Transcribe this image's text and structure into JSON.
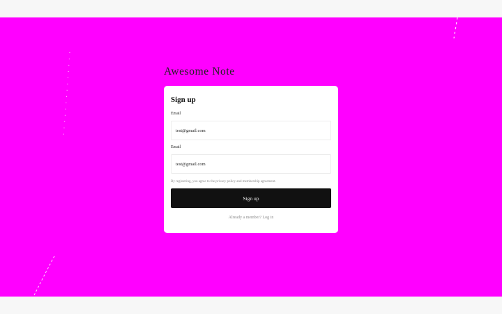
{
  "app": {
    "title": "Awesome Note"
  },
  "signup": {
    "heading": "Sign up",
    "fields": [
      {
        "label": "Email",
        "value": "test@gmail.com"
      },
      {
        "label": "Email",
        "value": "test@gmail.com"
      }
    ],
    "terms": "By registering, you agree to the privacy policy and membership agreement.",
    "submit_label": "Sign up",
    "footer_prompt": "Already a member?",
    "footer_link": "Log in"
  },
  "colors": {
    "page_background": "#f7f7f7",
    "stage_background": "#ff00ff",
    "card_background": "#ffffff",
    "button_background": "#111111"
  }
}
